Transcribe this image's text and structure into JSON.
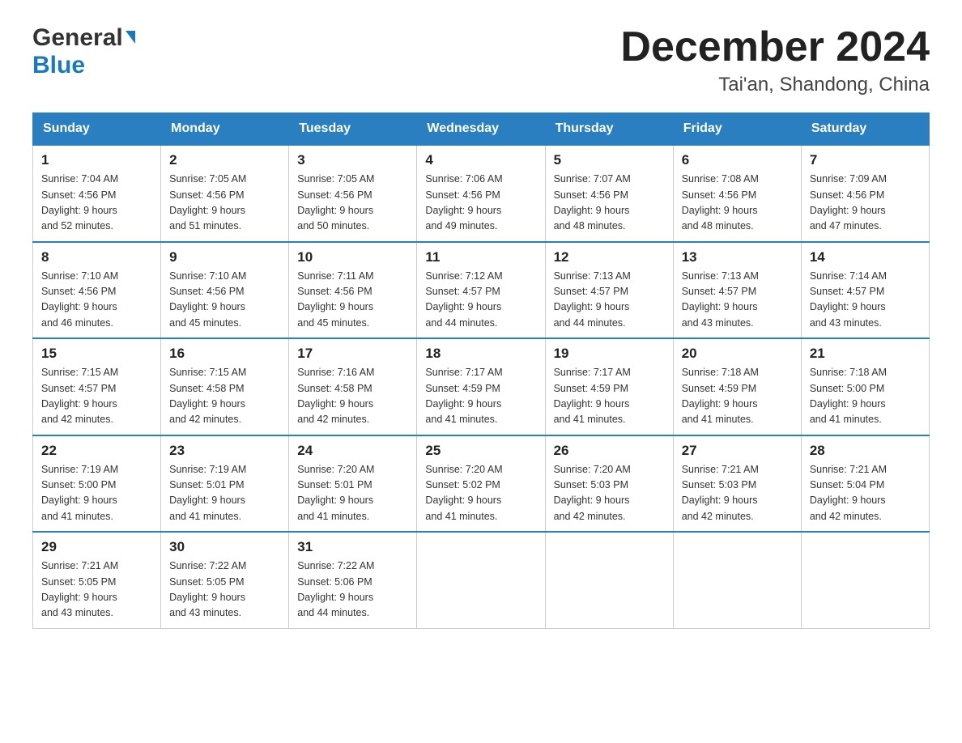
{
  "logo": {
    "general": "General",
    "blue": "Blue",
    "triangle": "▶"
  },
  "header": {
    "month_title": "December 2024",
    "location": "Tai'an, Shandong, China"
  },
  "weekdays": [
    "Sunday",
    "Monday",
    "Tuesday",
    "Wednesday",
    "Thursday",
    "Friday",
    "Saturday"
  ],
  "weeks": [
    [
      {
        "day": "1",
        "sunrise": "7:04 AM",
        "sunset": "4:56 PM",
        "daylight": "9 hours and 52 minutes."
      },
      {
        "day": "2",
        "sunrise": "7:05 AM",
        "sunset": "4:56 PM",
        "daylight": "9 hours and 51 minutes."
      },
      {
        "day": "3",
        "sunrise": "7:05 AM",
        "sunset": "4:56 PM",
        "daylight": "9 hours and 50 minutes."
      },
      {
        "day": "4",
        "sunrise": "7:06 AM",
        "sunset": "4:56 PM",
        "daylight": "9 hours and 49 minutes."
      },
      {
        "day": "5",
        "sunrise": "7:07 AM",
        "sunset": "4:56 PM",
        "daylight": "9 hours and 48 minutes."
      },
      {
        "day": "6",
        "sunrise": "7:08 AM",
        "sunset": "4:56 PM",
        "daylight": "9 hours and 48 minutes."
      },
      {
        "day": "7",
        "sunrise": "7:09 AM",
        "sunset": "4:56 PM",
        "daylight": "9 hours and 47 minutes."
      }
    ],
    [
      {
        "day": "8",
        "sunrise": "7:10 AM",
        "sunset": "4:56 PM",
        "daylight": "9 hours and 46 minutes."
      },
      {
        "day": "9",
        "sunrise": "7:10 AM",
        "sunset": "4:56 PM",
        "daylight": "9 hours and 45 minutes."
      },
      {
        "day": "10",
        "sunrise": "7:11 AM",
        "sunset": "4:56 PM",
        "daylight": "9 hours and 45 minutes."
      },
      {
        "day": "11",
        "sunrise": "7:12 AM",
        "sunset": "4:57 PM",
        "daylight": "9 hours and 44 minutes."
      },
      {
        "day": "12",
        "sunrise": "7:13 AM",
        "sunset": "4:57 PM",
        "daylight": "9 hours and 44 minutes."
      },
      {
        "day": "13",
        "sunrise": "7:13 AM",
        "sunset": "4:57 PM",
        "daylight": "9 hours and 43 minutes."
      },
      {
        "day": "14",
        "sunrise": "7:14 AM",
        "sunset": "4:57 PM",
        "daylight": "9 hours and 43 minutes."
      }
    ],
    [
      {
        "day": "15",
        "sunrise": "7:15 AM",
        "sunset": "4:57 PM",
        "daylight": "9 hours and 42 minutes."
      },
      {
        "day": "16",
        "sunrise": "7:15 AM",
        "sunset": "4:58 PM",
        "daylight": "9 hours and 42 minutes."
      },
      {
        "day": "17",
        "sunrise": "7:16 AM",
        "sunset": "4:58 PM",
        "daylight": "9 hours and 42 minutes."
      },
      {
        "day": "18",
        "sunrise": "7:17 AM",
        "sunset": "4:59 PM",
        "daylight": "9 hours and 41 minutes."
      },
      {
        "day": "19",
        "sunrise": "7:17 AM",
        "sunset": "4:59 PM",
        "daylight": "9 hours and 41 minutes."
      },
      {
        "day": "20",
        "sunrise": "7:18 AM",
        "sunset": "4:59 PM",
        "daylight": "9 hours and 41 minutes."
      },
      {
        "day": "21",
        "sunrise": "7:18 AM",
        "sunset": "5:00 PM",
        "daylight": "9 hours and 41 minutes."
      }
    ],
    [
      {
        "day": "22",
        "sunrise": "7:19 AM",
        "sunset": "5:00 PM",
        "daylight": "9 hours and 41 minutes."
      },
      {
        "day": "23",
        "sunrise": "7:19 AM",
        "sunset": "5:01 PM",
        "daylight": "9 hours and 41 minutes."
      },
      {
        "day": "24",
        "sunrise": "7:20 AM",
        "sunset": "5:01 PM",
        "daylight": "9 hours and 41 minutes."
      },
      {
        "day": "25",
        "sunrise": "7:20 AM",
        "sunset": "5:02 PM",
        "daylight": "9 hours and 41 minutes."
      },
      {
        "day": "26",
        "sunrise": "7:20 AM",
        "sunset": "5:03 PM",
        "daylight": "9 hours and 42 minutes."
      },
      {
        "day": "27",
        "sunrise": "7:21 AM",
        "sunset": "5:03 PM",
        "daylight": "9 hours and 42 minutes."
      },
      {
        "day": "28",
        "sunrise": "7:21 AM",
        "sunset": "5:04 PM",
        "daylight": "9 hours and 42 minutes."
      }
    ],
    [
      {
        "day": "29",
        "sunrise": "7:21 AM",
        "sunset": "5:05 PM",
        "daylight": "9 hours and 43 minutes."
      },
      {
        "day": "30",
        "sunrise": "7:22 AM",
        "sunset": "5:05 PM",
        "daylight": "9 hours and 43 minutes."
      },
      {
        "day": "31",
        "sunrise": "7:22 AM",
        "sunset": "5:06 PM",
        "daylight": "9 hours and 44 minutes."
      },
      null,
      null,
      null,
      null
    ]
  ],
  "labels": {
    "sunrise": "Sunrise:",
    "sunset": "Sunset:",
    "daylight": "Daylight:"
  }
}
